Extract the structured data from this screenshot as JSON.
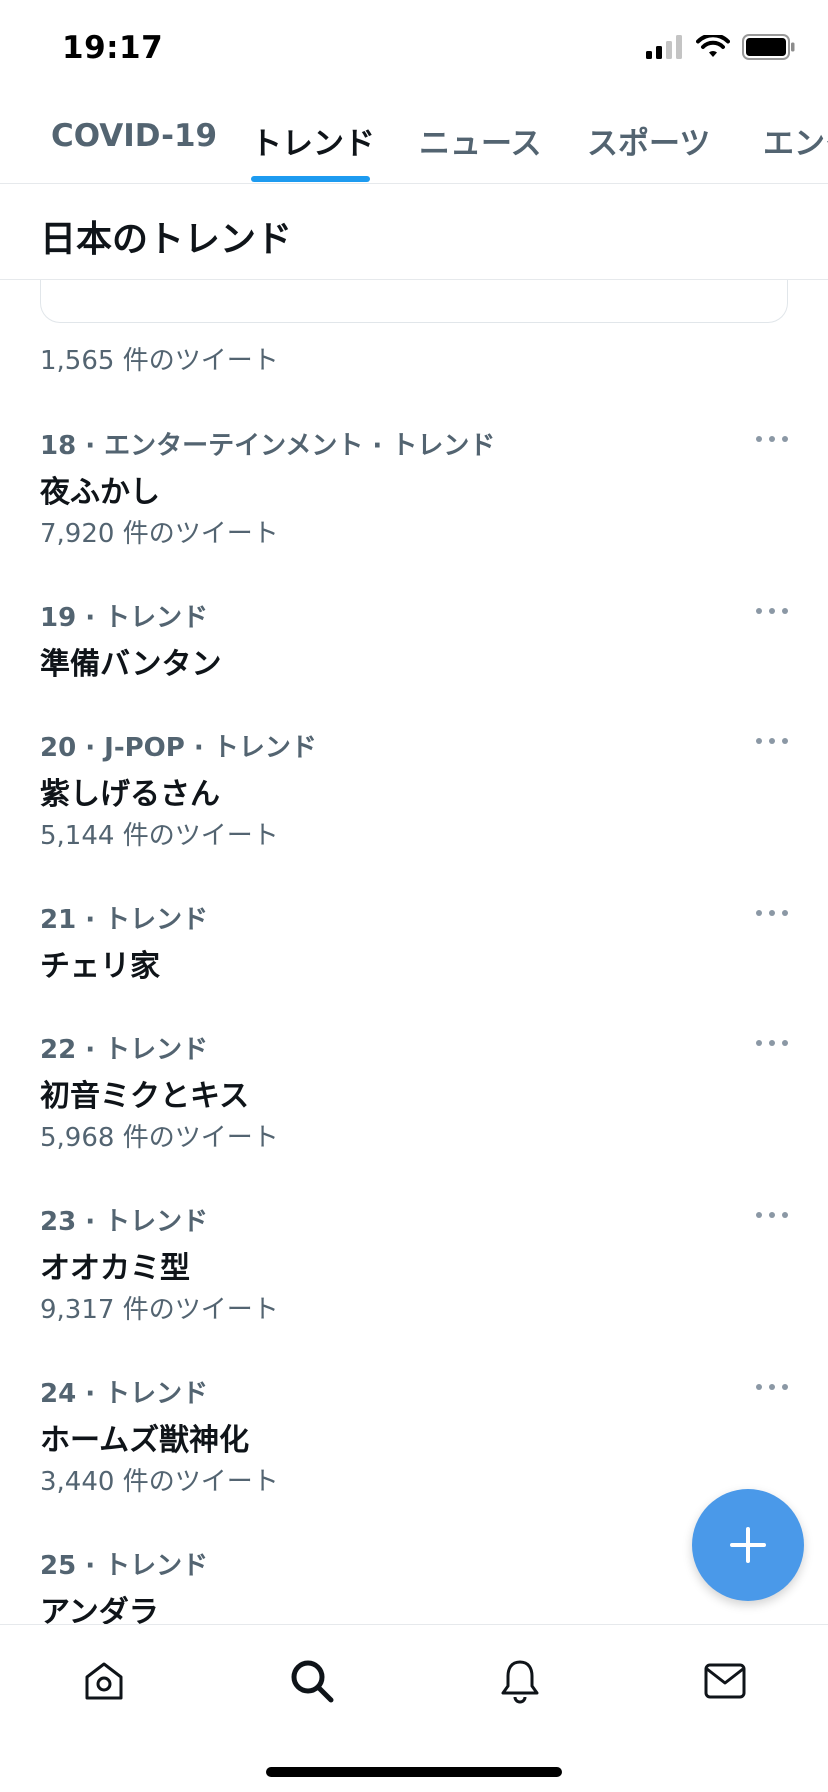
{
  "status_bar": {
    "time": "19:17"
  },
  "tabs": [
    {
      "label": "COVID-19",
      "active": false
    },
    {
      "label": "トレンド",
      "active": true
    },
    {
      "label": "ニュース",
      "active": false
    },
    {
      "label": "スポーツ",
      "active": false
    },
    {
      "label": "エンタ",
      "active": false
    }
  ],
  "section": {
    "title": "日本のトレンド"
  },
  "first_item": {
    "count": "1,565 件のツイート"
  },
  "trends": [
    {
      "meta": "18 · エンターテインメント · トレンド",
      "name": "夜ふかし",
      "count": "7,920 件のツイート"
    },
    {
      "meta": "19 · トレンド",
      "name": "準備バンタン",
      "count": ""
    },
    {
      "meta": "20 · J-POP · トレンド",
      "name": "紫しげるさん",
      "count": "5,144 件のツイート"
    },
    {
      "meta": "21 · トレンド",
      "name": "チェリ家",
      "count": ""
    },
    {
      "meta": "22 · トレンド",
      "name": "初音ミクとキス",
      "count": "5,968 件のツイート"
    },
    {
      "meta": "23 · トレンド",
      "name": "オオカミ型",
      "count": "9,317 件のツイート"
    },
    {
      "meta": "24 · トレンド",
      "name": "ホームズ獣神化",
      "count": "3,440 件のツイート"
    },
    {
      "meta": "25 · トレンド",
      "name": "アンダラ",
      "count": ""
    }
  ],
  "nav": [
    {
      "icon": "home-icon"
    },
    {
      "icon": "search-icon",
      "active": true
    },
    {
      "icon": "bell-icon"
    },
    {
      "icon": "mail-icon"
    }
  ],
  "colors": {
    "accent": "#1d9bf0",
    "fab": "#4a99e9",
    "secondary_text": "#536471"
  }
}
